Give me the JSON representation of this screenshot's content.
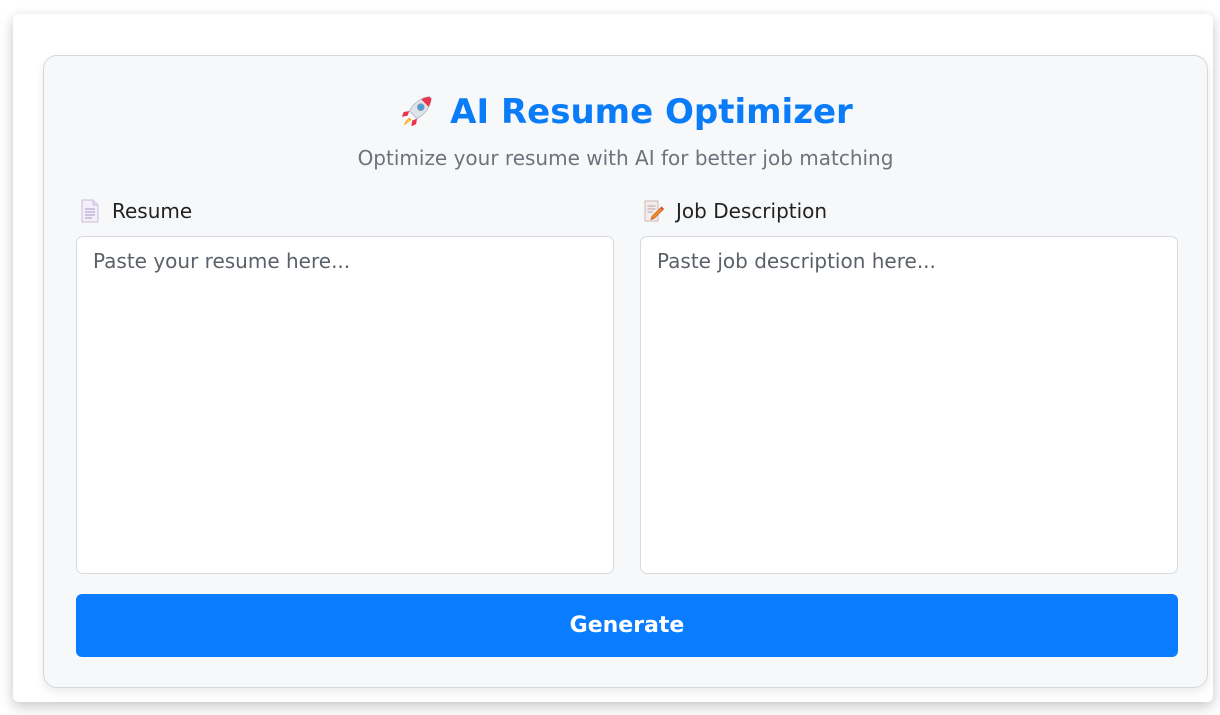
{
  "header": {
    "title": "AI Resume Optimizer",
    "title_icon": "rocket-icon",
    "subtitle": "Optimize your resume with AI for better job matching"
  },
  "resume": {
    "label": "Resume",
    "icon": "document-icon",
    "placeholder": "Paste your resume here...",
    "value": ""
  },
  "job": {
    "label": "Job Description",
    "icon": "memo-pencil-icon",
    "placeholder": "Paste job description here...",
    "value": ""
  },
  "actions": {
    "generate_label": "Generate"
  },
  "colors": {
    "accent": "#0a7cff",
    "title": "#0a7cf7",
    "card_background": "#f7f8fa",
    "subtitle": "#6c737c"
  }
}
